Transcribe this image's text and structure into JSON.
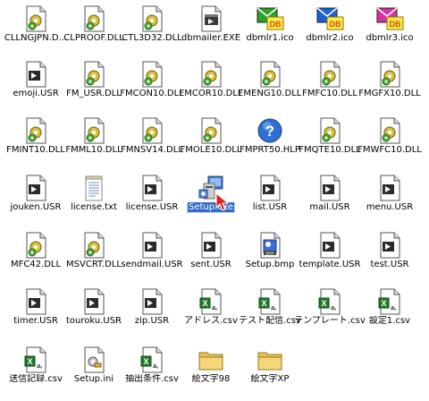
{
  "files": [
    {
      "name": "CLLNGJPN.D...",
      "icon": "dll-gear-icon"
    },
    {
      "name": "CLPROOF.DLL",
      "icon": "dll-gear-icon"
    },
    {
      "name": "CTL3D32.DLL",
      "icon": "dll-gear-icon"
    },
    {
      "name": "dbmailer.EXE",
      "icon": "exe-window-icon"
    },
    {
      "name": "dbmlr1.ico",
      "icon": "ico-envelope-icon",
      "color": "#29a329"
    },
    {
      "name": "dbmlr2.ico",
      "icon": "ico-envelope-icon",
      "color": "#1e5fd6"
    },
    {
      "name": "dbmlr3.ico",
      "icon": "ico-envelope-icon",
      "color": "#d6339e"
    },
    {
      "name": "emoji.USR",
      "icon": "usr-file-icon"
    },
    {
      "name": "FM_USR.DLL",
      "icon": "dll-gear-icon"
    },
    {
      "name": "FMCON10.DLL",
      "icon": "dll-gear-icon"
    },
    {
      "name": "FMCOR10.DLL",
      "icon": "dll-gear-icon"
    },
    {
      "name": "FMENG10.DLL",
      "icon": "dll-gear-icon"
    },
    {
      "name": "FMFC10.DLL",
      "icon": "dll-gear-icon"
    },
    {
      "name": "FMGFX10.DLL",
      "icon": "dll-gear-icon"
    },
    {
      "name": "FMINT10.DLL",
      "icon": "dll-gear-icon"
    },
    {
      "name": "FMML10.DLL",
      "icon": "dll-gear-icon"
    },
    {
      "name": "FMNSV14.DLL",
      "icon": "dll-gear-icon"
    },
    {
      "name": "FMOLE10.DLL",
      "icon": "dll-gear-icon"
    },
    {
      "name": "FMPRT50.HLP",
      "icon": "help-file-icon"
    },
    {
      "name": "FMQTE10.DLL",
      "icon": "dll-gear-icon"
    },
    {
      "name": "FMWFC10.DLL",
      "icon": "dll-gear-icon"
    },
    {
      "name": "jouken.USR",
      "icon": "usr-file-icon"
    },
    {
      "name": "license.txt",
      "icon": "text-file-icon"
    },
    {
      "name": "license.USR",
      "icon": "usr-file-icon"
    },
    {
      "name": "Setup.exe",
      "icon": "setup-installer-icon",
      "selected": true
    },
    {
      "name": "list.USR",
      "icon": "usr-file-icon"
    },
    {
      "name": "mail.USR",
      "icon": "usr-file-icon"
    },
    {
      "name": "menu.USR",
      "icon": "usr-file-icon"
    },
    {
      "name": "MFC42.DLL",
      "icon": "dll-gear-icon"
    },
    {
      "name": "MSVCRT.DLL",
      "icon": "dll-gear-icon"
    },
    {
      "name": "sendmail.USR",
      "icon": "usr-file-icon"
    },
    {
      "name": "sent.USR",
      "icon": "usr-file-icon"
    },
    {
      "name": "Setup.bmp",
      "icon": "bmp-file-icon"
    },
    {
      "name": "template.USR",
      "icon": "usr-file-icon"
    },
    {
      "name": "test.USR",
      "icon": "usr-file-icon"
    },
    {
      "name": "timer.USR",
      "icon": "usr-file-icon"
    },
    {
      "name": "touroku.USR",
      "icon": "usr-file-icon"
    },
    {
      "name": "zip.USR",
      "icon": "usr-file-icon"
    },
    {
      "name": "アドレス.csv",
      "icon": "csv-excel-icon"
    },
    {
      "name": "テスト配信.csv",
      "icon": "csv-excel-icon"
    },
    {
      "name": "テンプレート.csv",
      "icon": "csv-excel-icon"
    },
    {
      "name": "設定1.csv",
      "icon": "csv-excel-icon"
    },
    {
      "name": "送信記録.csv",
      "icon": "csv-excel-icon"
    },
    {
      "name": "Setup.ini",
      "icon": "ini-settings-icon"
    },
    {
      "name": "抽出条件.csv",
      "icon": "csv-excel-icon"
    },
    {
      "name": "絵文字98",
      "icon": "folder-icon"
    },
    {
      "name": "絵文字XP",
      "icon": "folder-icon"
    }
  ],
  "selection_color": "#316ac5"
}
